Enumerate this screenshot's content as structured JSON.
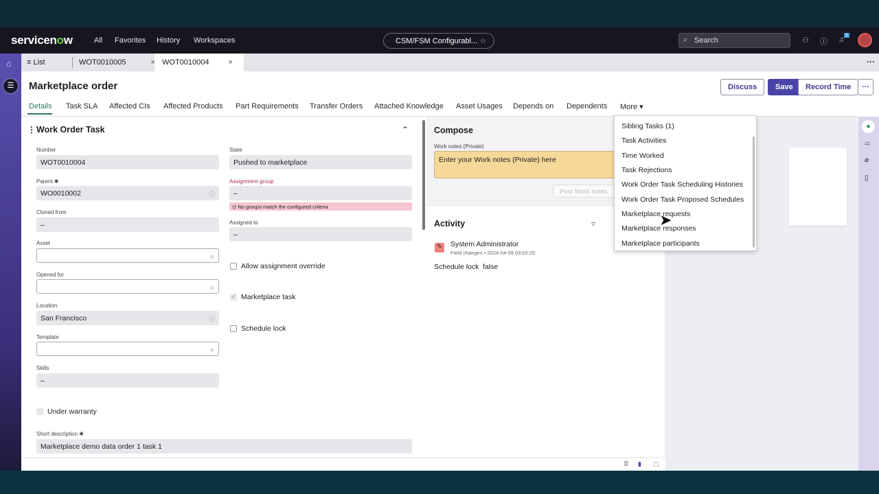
{
  "topnav": {
    "logo_a": "servicen",
    "logo_b": "o",
    "logo_c": "w",
    "links": [
      "All",
      "Favorites",
      "History",
      "Workspaces"
    ],
    "context": "CSM/FSM Configurabl...",
    "search_placeholder": "Search",
    "notif_count": "1"
  },
  "tabs": {
    "list": "List",
    "items": [
      "WOT0010005",
      "WOT0010004"
    ],
    "active": 1
  },
  "record": {
    "title": "Marketplace order",
    "buttons": {
      "discuss": "Discuss",
      "save": "Save",
      "record_time": "Record Time",
      "more": "···"
    },
    "related_tabs": [
      "Details",
      "Task SLA",
      "Affected CIs",
      "Affected Products",
      "Part Requirements",
      "Transfer Orders",
      "Attached Knowledge",
      "Asset Usages",
      "Depends on",
      "Dependents",
      "More ▾"
    ]
  },
  "form": {
    "section": "Work Order Task",
    "number_label": "Number",
    "number": "WOT0010004",
    "parent_label": "Parent ✱",
    "parent": "WO0010002",
    "cloned_label": "Cloned from",
    "cloned": "–",
    "asset_label": "Asset",
    "opened_for_label": "Opened for",
    "location_label": "Location",
    "location": "San Francisco",
    "template_label": "Template",
    "skills_label": "Skills",
    "skills": "–",
    "under_warranty": "Under warranty",
    "short_desc_label": "Short description ✱",
    "short_desc": "Marketplace demo data order 1 task 1",
    "state_label": "State",
    "state": "Pushed to marketplace",
    "assignment_group_label": "Assignment group",
    "assignment_group": "–",
    "assignment_error": "No groups match the configured criteria",
    "assigned_to_label": "Assigned to",
    "assigned_to": "–",
    "allow_override": "Allow assignment override",
    "marketplace_task": "Marketplace task",
    "schedule_lock": "Schedule lock"
  },
  "compose": {
    "title": "Compose",
    "work_notes_label": "Work notes (Private)",
    "placeholder": "Enter your Work notes (Private) here",
    "post": "Post Work notes"
  },
  "activity": {
    "title": "Activity",
    "author": "System Administrator",
    "meta": "Field changes • 2024-04-09 03:02:25",
    "field": "Schedule lock",
    "value": "false"
  },
  "more_menu": [
    "Sibling Tasks (1)",
    "Task Activities",
    "Time Worked",
    "Task Rejections",
    "Work Order Task Scheduling Histories",
    "Work Order Task Proposed Schedules",
    "Marketplace requests",
    "Marketplace responses",
    "Marketplace participants"
  ],
  "colors": {
    "accent": "#4b44a8",
    "error": "#f5c6cf",
    "work_notes": "#f6d899"
  }
}
